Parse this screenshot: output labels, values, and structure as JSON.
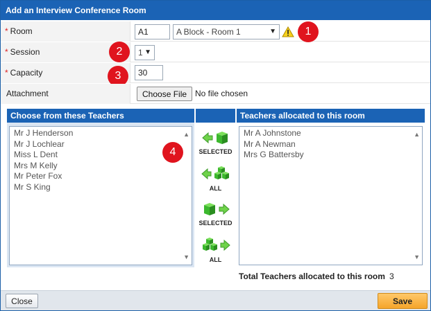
{
  "dialog": {
    "title": "Add an Interview Conference Room"
  },
  "form": {
    "room": {
      "label": "Room",
      "code_value": "A1",
      "select_value": "A Block - Room 1",
      "badge": "1"
    },
    "session": {
      "label": "Session",
      "select_value": "1",
      "badge": "2"
    },
    "capacity": {
      "label": "Capacity",
      "value": "30",
      "badge": "3"
    },
    "attachment": {
      "label": "Attachment",
      "button_label": "Choose File",
      "status": "No file chosen"
    },
    "required_marker": "*"
  },
  "teachers": {
    "available_title": "Choose from these Teachers",
    "available": [
      "Mr J Henderson",
      "Mr J Lochlear",
      "Miss L Dent",
      "Mrs M Kelly",
      "Mr Peter Fox",
      "Mr S King"
    ],
    "available_badge": "4",
    "allocated_title": "Teachers allocated to this room",
    "allocated": [
      "Mr A Johnstone",
      "Mr A Newman",
      "Mrs G Battersby"
    ],
    "total_label": "Total Teachers allocated to this room",
    "total_value": "3"
  },
  "move_buttons": {
    "remove_selected": "SELECTED",
    "remove_all": "ALL",
    "add_selected": "SELECTED",
    "add_all": "ALL"
  },
  "footer": {
    "close_label": "Close",
    "save_label": "Save"
  },
  "colors": {
    "header": "#1b63b5",
    "badge": "#e0141e",
    "save": "#f5a52a",
    "cube": "#3cb82e"
  }
}
